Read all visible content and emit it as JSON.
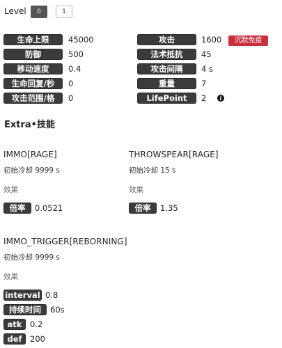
{
  "level": {
    "label": "Level",
    "options": [
      "0",
      "1"
    ]
  },
  "stats_left": [
    {
      "label": "生命上限",
      "value": "45000"
    },
    {
      "label": "防御",
      "value": "500"
    },
    {
      "label": "移动速度",
      "value": "0.4"
    },
    {
      "label": "生命回复/秒",
      "value": "0"
    },
    {
      "label": "攻击范围/格",
      "value": "0"
    }
  ],
  "stats_right": [
    {
      "label": "攻击",
      "value": "1600"
    },
    {
      "label": "法术抵抗",
      "value": "45"
    },
    {
      "label": "攻击间隔",
      "value": "4 s"
    },
    {
      "label": "重量",
      "value": "7"
    },
    {
      "label": "LifePoint",
      "value": "2"
    }
  ],
  "badge": "沉默免疫",
  "section_title": "Extra•技能",
  "skills": [
    {
      "name": "IMMO[RAGE]",
      "cooldown": "初始冷却 9999 s",
      "effect_label": "效果",
      "effects": [
        {
          "label": "倍率",
          "value": "0.0521"
        }
      ]
    },
    {
      "name": "THROWSPEAR[RAGE]",
      "cooldown": "初始冷却 15 s",
      "effect_label": "效果",
      "effects": [
        {
          "label": "倍率",
          "value": "1.35"
        }
      ]
    },
    {
      "name": "IMMO_TRIGGER[REBORNING]",
      "cooldown": "初始冷却 9999 s",
      "effect_label": "效果",
      "effects": [
        {
          "label": "interval",
          "value": "0.8"
        },
        {
          "label": "持续时间",
          "value": "60s"
        },
        {
          "label": "atk",
          "value": "0.2"
        },
        {
          "label": "def",
          "value": "200"
        }
      ]
    }
  ],
  "colors": {
    "tag_bg": "#3b3b3b",
    "badge_bg": "#c8303b"
  }
}
